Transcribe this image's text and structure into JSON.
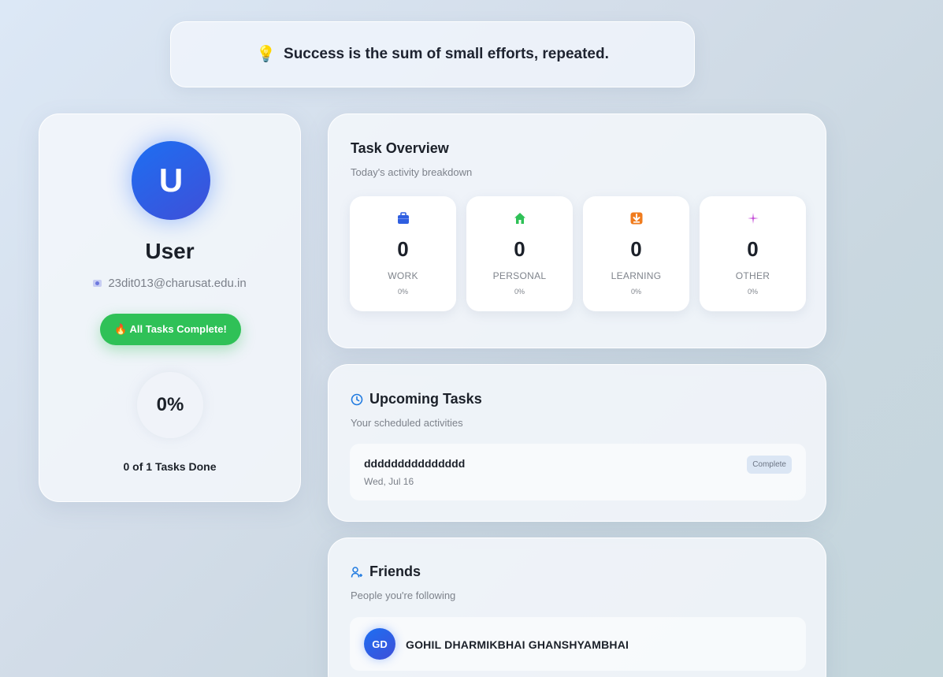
{
  "quote": {
    "icon": "lightbulb-icon",
    "text": "Success is the sum of small efforts, repeated."
  },
  "profile": {
    "avatar_initial": "U",
    "name": "User",
    "email_icon": "id-card-icon",
    "email": "23dit013@charusat.edu.in",
    "status_badge": "🔥 All Tasks Complete!",
    "status_color": "#2fc157",
    "progress_percent": "0%",
    "tasks_done": "0 of 1 Tasks Done"
  },
  "overview": {
    "title": "Task Overview",
    "subtitle": "Today's activity breakdown",
    "stats": [
      {
        "icon": "briefcase-icon",
        "color": "#2f5fe0",
        "value": "0",
        "label": "WORK",
        "percent": "0%"
      },
      {
        "icon": "home-icon",
        "color": "#2fc157",
        "value": "0",
        "label": "PERSONAL",
        "percent": "0%"
      },
      {
        "icon": "download-icon",
        "color": "#f07c1e",
        "value": "0",
        "label": "LEARNING",
        "percent": "0%"
      },
      {
        "icon": "sparkle-icon",
        "color": "#c145d6",
        "value": "0",
        "label": "OTHER",
        "percent": "0%"
      }
    ]
  },
  "upcoming": {
    "icon": "clock-icon",
    "title": "Upcoming Tasks",
    "subtitle": "Your scheduled activities",
    "tasks": [
      {
        "name": "ddddddddddddddd",
        "date": "Wed, Jul 16",
        "status": "Complete"
      }
    ]
  },
  "friends": {
    "icon": "user-plus-icon",
    "title": "Friends",
    "subtitle": "People you're following",
    "list": [
      {
        "initials": "GD",
        "name": "GOHIL DHARMIKBHAI GHANSHYAMBHAI"
      }
    ]
  }
}
